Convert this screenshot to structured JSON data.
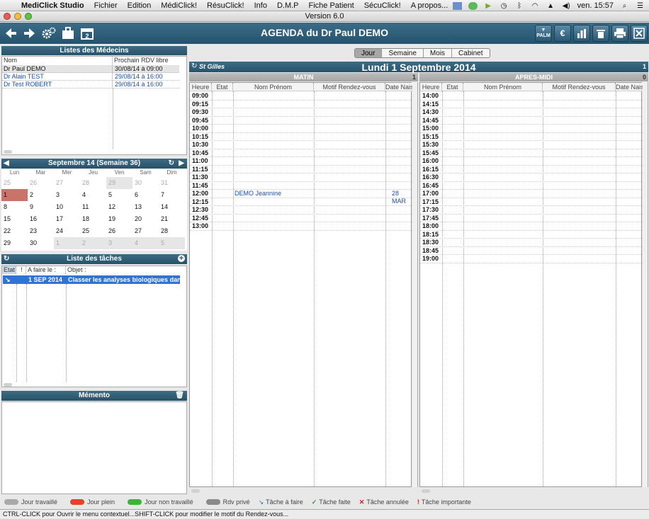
{
  "menubar": {
    "app_name": "MediClick Studio",
    "items": [
      "Fichier",
      "Edition",
      "MédiClick!",
      "RésuClick!",
      "Info",
      "D.M.P",
      "Fiche Patient",
      "SécuClick!",
      "A propos..."
    ],
    "clock": "ven. 15:57"
  },
  "window": {
    "title": "Version 6.0"
  },
  "toolbar": {
    "title": "AGENDA du Dr Paul DEMO",
    "palm_label": "PALM"
  },
  "medecins": {
    "header": "Listes des Médecins",
    "col_nom": "Nom",
    "col_rdv": "Prochain RDV libre",
    "rows": [
      {
        "nom": "Dr Paul DEMO",
        "rdv": "30/08/14 à 09:00"
      },
      {
        "nom": "Dr Alain TEST",
        "rdv": "29/08/14 à 16:00"
      },
      {
        "nom": "Dr Test ROBERT",
        "rdv": "29/08/14 à 16:00"
      }
    ]
  },
  "calendar": {
    "header": "Septembre 14 (Semaine 36)",
    "weekdays": [
      "Lun",
      "Mar",
      "Mer",
      "Jeu",
      "Ven",
      "Sam",
      "Dim"
    ],
    "weeks": [
      [
        "25",
        "26",
        "27",
        "28",
        "29",
        "30",
        "31"
      ],
      [
        "1",
        "2",
        "3",
        "4",
        "5",
        "6",
        "7"
      ],
      [
        "8",
        "9",
        "10",
        "11",
        "12",
        "13",
        "14"
      ],
      [
        "15",
        "16",
        "17",
        "18",
        "19",
        "20",
        "21"
      ],
      [
        "22",
        "23",
        "24",
        "25",
        "26",
        "27",
        "28"
      ],
      [
        "29",
        "30",
        "1",
        "2",
        "3",
        "4",
        "5"
      ]
    ]
  },
  "taches": {
    "header": "Liste des tâches",
    "col_etat": "Etat",
    "col_bang": "!",
    "col_date": "A faire le :",
    "col_objet": "Objet :",
    "row": {
      "etat": "↘",
      "date": "1 SEP 2014",
      "objet": "Classer les analyses biologiques dans les"
    }
  },
  "memento": {
    "header": "Mémento"
  },
  "agenda": {
    "tabs": [
      "Jour",
      "Semaine",
      "Mois",
      "Cabinet"
    ],
    "location": "St Gilles",
    "date": "Lundi 1 Septembre 2014",
    "count": "1",
    "matin": {
      "label": "MATIN",
      "count": "1",
      "columns": [
        "Heure",
        "Etat",
        "Nom Prénom",
        "Motif Rendez-vous",
        "Date Naissance"
      ],
      "slots": [
        "09:00",
        "09:15",
        "09:30",
        "09:45",
        "10:00",
        "10:15",
        "10:30",
        "10:45",
        "11:00",
        "11:15",
        "11:30",
        "11:45",
        "12:00",
        "12:15",
        "12:30",
        "12:45",
        "13:00"
      ],
      "appointment": {
        "nom": "DEMO Jeannine",
        "naissance": "28 MAR"
      }
    },
    "apresmidi": {
      "label": "APRES-MIDI",
      "count": "0",
      "columns": [
        "Heure",
        "Etat",
        "Nom Prénom",
        "Motif Rendez-vous",
        "Date Naissance"
      ],
      "slots": [
        "14:00",
        "14:15",
        "14:30",
        "14:45",
        "15:00",
        "15:15",
        "15:30",
        "15:45",
        "16:00",
        "16:15",
        "16:30",
        "16:45",
        "17:00",
        "17:15",
        "17:30",
        "17:45",
        "18:00",
        "18:15",
        "18:30",
        "18:45",
        "19:00"
      ]
    }
  },
  "legend": [
    {
      "label": "Jour travaillé",
      "color": "#a9a9a9"
    },
    {
      "label": "Jour plein",
      "color": "#e8402a"
    },
    {
      "label": "Jour non travaillé",
      "color": "#3cb43c"
    },
    {
      "label": "Rdv privé",
      "color": "#8a8a8a"
    }
  ],
  "legend_marks": [
    {
      "label": "Tâche à faire",
      "mark": "↘",
      "color": "#3a6fc8"
    },
    {
      "label": "Tâche faite",
      "mark": "✓",
      "color": "#2a9a2a"
    },
    {
      "label": "Tâche annulée",
      "mark": "✕",
      "color": "#d02020"
    },
    {
      "label": "Tâche importante",
      "mark": "!",
      "color": "#d02020"
    }
  ],
  "status": "CTRL-CLICK pour Ouvrir le menu contextuel...SHIFT-CLICK pour modifier le motif du Rendez-vous..."
}
